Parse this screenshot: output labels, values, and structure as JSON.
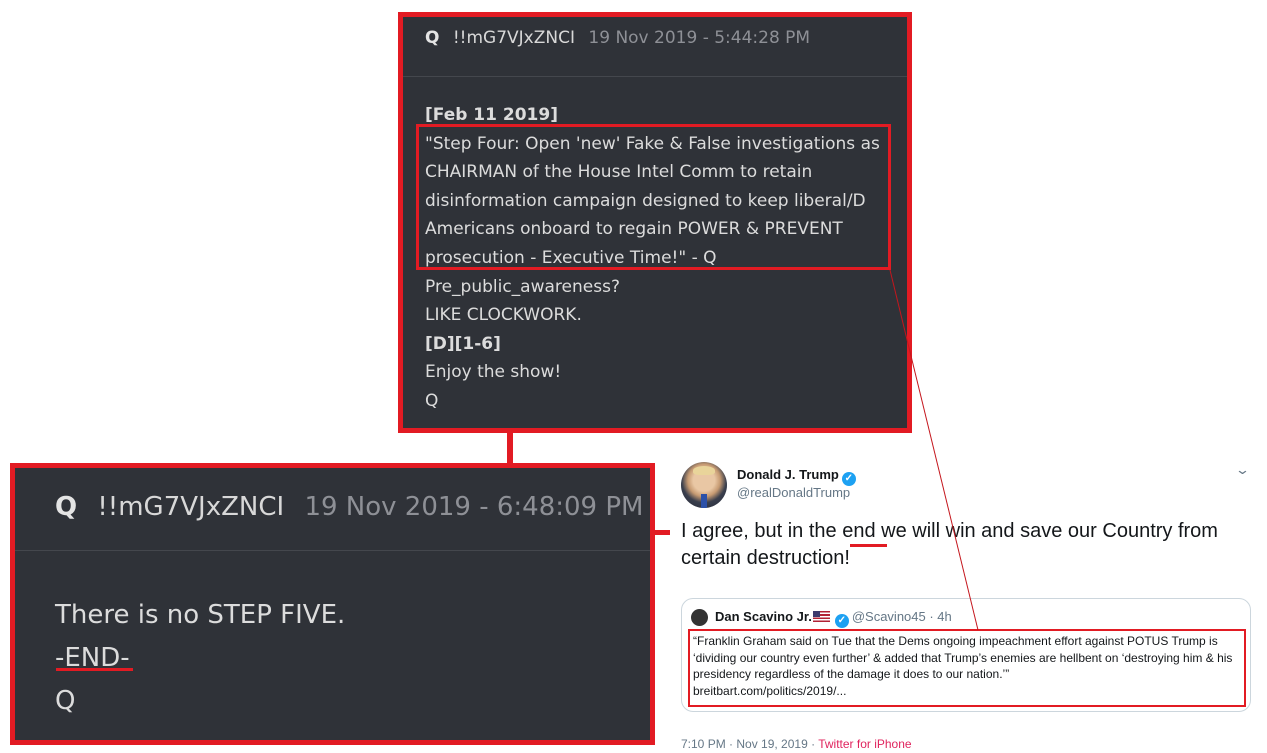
{
  "qpost_top": {
    "name": "Q",
    "trip": "!!mG7VJxZNCI",
    "date": "19 Nov 2019 - 5:44:28 PM",
    "lines": [
      {
        "text": "[Feb 11 2019]",
        "bold": true
      },
      {
        "text": "\"Step Four: Open 'new' Fake & False investigations as",
        "bold": false
      },
      {
        "text": "CHAIRMAN of the House Intel Comm to retain",
        "bold": false
      },
      {
        "text": "disinformation campaign designed to keep liberal/D",
        "bold": false
      },
      {
        "text": "Americans onboard to regain POWER & PREVENT",
        "bold": false
      },
      {
        "text": "prosecution - Executive Time!\" - Q",
        "bold": false
      },
      {
        "text": "Pre_public_awareness?",
        "bold": false
      },
      {
        "text": "LIKE CLOCKWORK.",
        "bold": false
      },
      {
        "text": "[D][1-6]",
        "bold": true
      },
      {
        "text": "Enjoy the show!",
        "bold": false
      },
      {
        "text": "Q",
        "bold": false
      }
    ]
  },
  "qpost_bottom": {
    "name": "Q",
    "trip": "!!mG7VJxZNCI",
    "date": "19 Nov 2019 - 6:48:09 PM",
    "lines": [
      "There is no STEP FIVE.",
      "-END-",
      "Q"
    ]
  },
  "tweet": {
    "display_name": "Donald J. Trump",
    "handle": "@realDonaldTrump",
    "text_before": "I agree, but in the ",
    "text_highlight": "end",
    "text_after": " we will win and save our Country from certain destruction!",
    "quoted": {
      "name": "Dan Scavino Jr.",
      "handle": "@Scavino45 · 4h",
      "text": "“Franklin Graham said on Tue that the Dems ongoing impeachment effort against POTUS Trump is ‘dividing our country even further’ & added that Trump’s enemies are hellbent on ‘destroying him & his presidency regardless of the damage it does to our nation.’”",
      "link": "breitbart.com/politics/2019/..."
    },
    "time": "7:10 PM · Nov 19, 2019 · ",
    "source": "Twitter for iPhone"
  },
  "icons": {
    "verified": "verified-checkmark-icon",
    "chevron": "chevron-down-icon"
  },
  "colors": {
    "highlight_red": "#e21b23",
    "qpost_bg": "#2f3238",
    "twitter_blue": "#1da1f2",
    "source_pink": "#e0245e"
  }
}
